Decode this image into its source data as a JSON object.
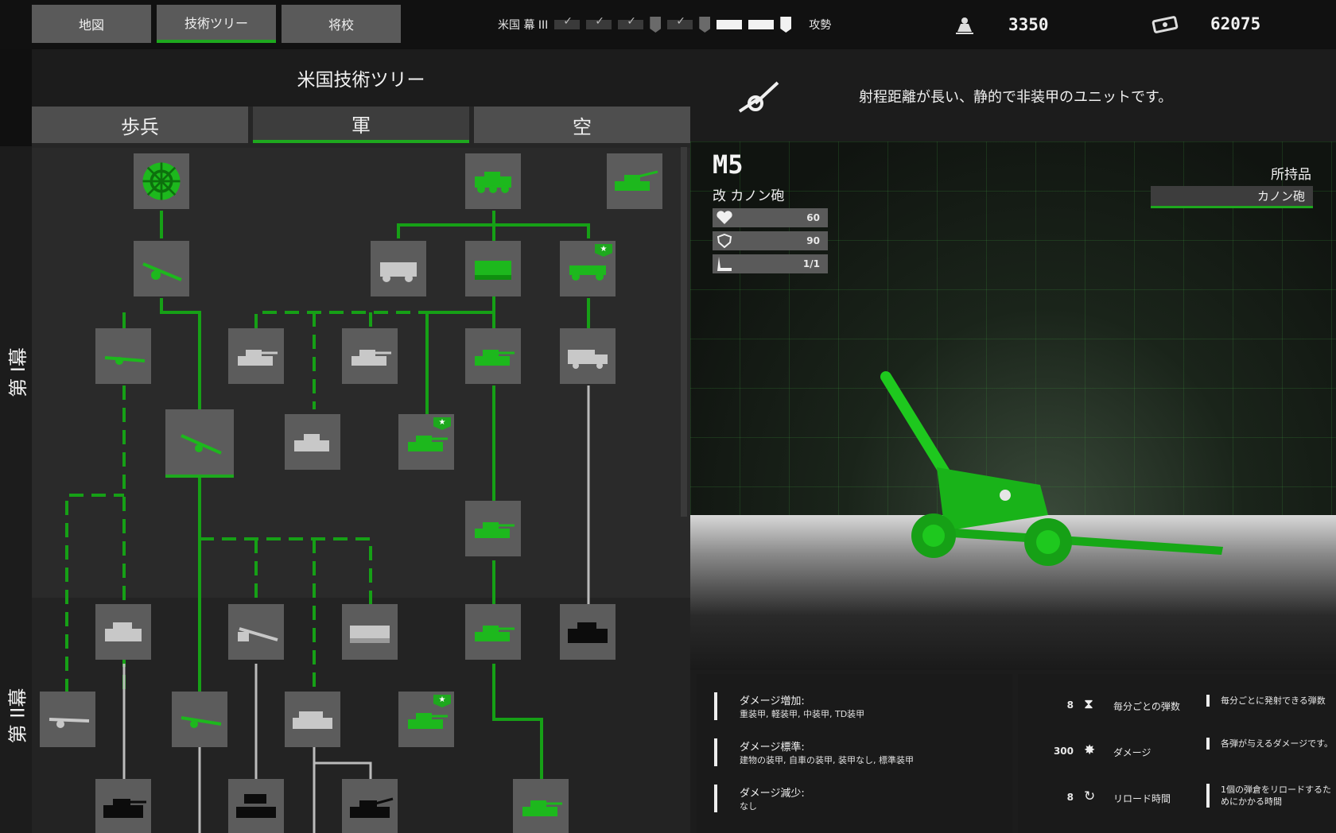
{
  "top_tabs": [
    {
      "label": "地図",
      "active": false
    },
    {
      "label": "技術ツリー",
      "active": true
    },
    {
      "label": "将校",
      "active": false
    }
  ],
  "progress": {
    "label": "米国 幕 III",
    "end_label": "攻勢"
  },
  "resources": [
    {
      "icon": "officer-point-icon",
      "value": "3350"
    },
    {
      "icon": "money-icon",
      "value": "62075"
    }
  ],
  "tree": {
    "title": "米国技術ツリー",
    "category_tabs": [
      {
        "label": "歩兵",
        "active": false
      },
      {
        "label": "軍",
        "active": true
      },
      {
        "label": "空",
        "active": false
      }
    ],
    "era_labels": [
      "第 I幕",
      "第 II幕"
    ]
  },
  "detail": {
    "description": "射程距離が長い、静的で非装甲のユニットです。",
    "unit_name": "M5",
    "unit_type": "改 カノン砲",
    "stats": [
      {
        "icon": "heart-icon",
        "value": "60"
      },
      {
        "icon": "shield-icon",
        "value": "90"
      },
      {
        "icon": "seat-icon",
        "value": "1/1"
      }
    ],
    "owned_label": "所持品",
    "owned_value": "カノン砲"
  },
  "damage": [
    {
      "heading": "ダメージ増加:",
      "body": "重装甲, 軽装甲, 中装甲, TD装甲"
    },
    {
      "heading": "ダメージ標準:",
      "body": "建物の装甲, 自車の装甲, 装甲なし, 標準装甲"
    },
    {
      "heading": "ダメージ減少:",
      "body": "なし"
    }
  ],
  "stat_rows": [
    {
      "value": "8",
      "icon": "hourglass-icon",
      "name": "毎分ごとの弾数",
      "desc": "毎分ごとに発射できる弾数"
    },
    {
      "value": "300",
      "icon": "explosion-icon",
      "name": "ダメージ",
      "desc": "各弾が与えるダメージです。"
    },
    {
      "value": "8",
      "icon": "reload-icon",
      "name": "リロード時間",
      "desc": "1個の弾倉をリロードするためにかかる時間"
    }
  ],
  "colors": {
    "accent": "#1ea81e",
    "tile": "#5c5c5c",
    "unlocked_unit": "#1db81d",
    "locked_unit": "#c8c8c8"
  }
}
